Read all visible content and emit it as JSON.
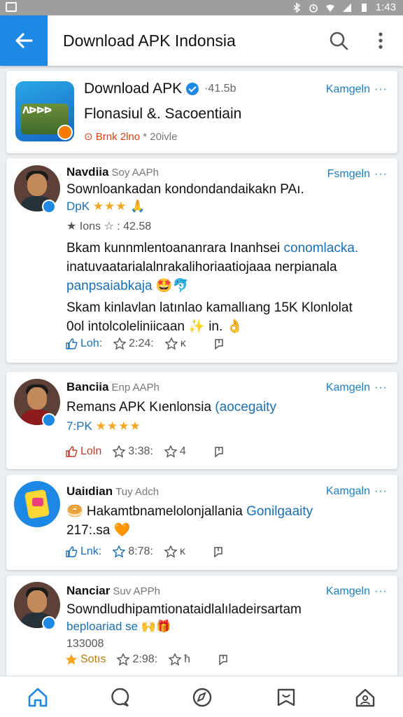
{
  "status_bar": {
    "time": "1:43"
  },
  "app_bar": {
    "title": "Download APK Indonsia"
  },
  "feature_card": {
    "app_name": "Download APK",
    "size": "·41.5b",
    "subtitle": "Flonasiul &. Sacoentiain",
    "meta_red": "⊙ Brnk 2lno",
    "meta_rest": "* 20ivle",
    "icon_label": "ᐱᐅᐅᐅ",
    "action": "Kamgeln",
    "action_dots": "···"
  },
  "posts": [
    {
      "name": "Navdiia",
      "meta": "Soy AAPh",
      "action": "Fsmgeln",
      "action_dots": "···",
      "line1": "Sownloankadan kondondandaikakn PAı.",
      "line2_blue": "DpK",
      "line2_stars": "★★★",
      "line2_emoji": "🙏",
      "line3": "★ Ions ☆ : 42.58",
      "para1": [
        "Bkam kunnmlentoananrara Inanhsei",
        "inatuvaatarialalnrakalihoriaatiojaaa nerpianala",
        "panpsaiabkaja"
      ],
      "para1_blue": "conomlacka.",
      "para1_tail": "🤩🐬",
      "para2": [
        "Skam kinlavlan latınlao kamallıang 15K Klonlolat",
        "0ol intolcoleliniicaan ✨ in. 👌"
      ],
      "stats": {
        "like": "Loh:",
        "s1": "2:24:",
        "s2": "ᴋ"
      }
    },
    {
      "name": "Banciia",
      "meta": "Enp AAPh",
      "action": "Kamgeln",
      "action_dots": "···",
      "line1": "Remans APK Kıenlonsia",
      "line1_blue": "(aocegaity",
      "line2_blue": "7:PK",
      "line2_stars": "★★★★",
      "stats": {
        "like": "Loln",
        "s1": "3:38:",
        "s2": "4"
      }
    },
    {
      "name": "Uaiıdian",
      "meta": "Tuy Adch",
      "action": "Kamgaln",
      "action_dots": "···",
      "line1": "🥯 Hakamtbnamelolonjallania",
      "line1_blue": "Gonilgaaity",
      "line2": "217:.sa 🧡",
      "stats": {
        "like": "Lnk:",
        "s1": "8:78:",
        "s2": "ĸ"
      }
    },
    {
      "name": "Nanciar",
      "meta": "Suv APPh",
      "action": "Kamgeln",
      "action_dots": "···",
      "line1": "Sowndludhipamtionataidlalıladeirsartam",
      "line2_blue": "beploariad se",
      "line2_emoji": "🙌🎁",
      "line3": "133008",
      "stats": {
        "like": "Sotıs",
        "s1": "2:98:",
        "s2": "ħ"
      }
    }
  ],
  "bottom_nav": {
    "items": [
      "home-icon",
      "chat-icon",
      "discover-icon",
      "saved-icon",
      "profile-icon"
    ]
  },
  "colors": {
    "accent": "#1e88e5",
    "link": "#1a7fc4",
    "star": "#f5a623"
  }
}
